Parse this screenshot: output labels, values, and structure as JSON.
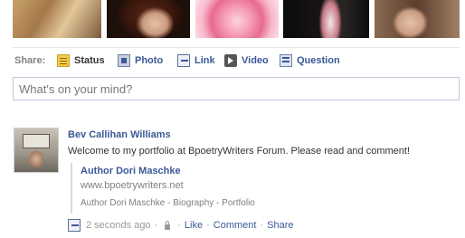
{
  "photos": [
    {
      "name": "photo-1"
    },
    {
      "name": "photo-2"
    },
    {
      "name": "photo-3"
    },
    {
      "name": "photo-4"
    },
    {
      "name": "photo-5"
    }
  ],
  "share_bar": {
    "label": "Share:",
    "options": [
      {
        "label": "Status",
        "icon": "status-icon",
        "active": true
      },
      {
        "label": "Photo",
        "icon": "photo-icon"
      },
      {
        "label": "Link",
        "icon": "link-icon"
      },
      {
        "label": "Video",
        "icon": "video-icon"
      },
      {
        "label": "Question",
        "icon": "question-icon"
      }
    ]
  },
  "composer": {
    "placeholder": "What's on your mind?"
  },
  "story": {
    "author": "Bev Callihan Williams",
    "message": "Welcome to my portfolio at BpoetryWriters Forum. Please read and comment!",
    "attachment": {
      "title": "Author Dori Maschke",
      "url": "www.bpoetrywriters.net",
      "description": "Author Dori Maschke - Biography - Portfolio"
    },
    "meta": {
      "timestamp": "2 seconds ago",
      "separator": "·",
      "like": "Like",
      "comment": "Comment",
      "share": "Share"
    }
  },
  "colors": {
    "link": "#3b5998",
    "text": "#333333",
    "muted": "#808080",
    "input_border": "#bdc7d8"
  }
}
